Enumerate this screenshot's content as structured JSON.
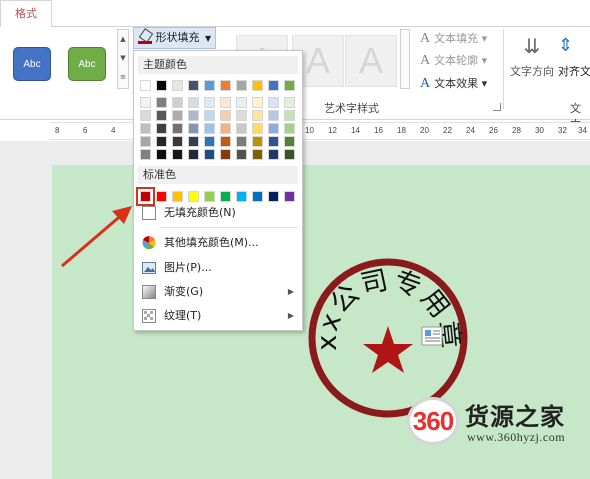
{
  "tabs": {
    "format": "格式"
  },
  "ribbon": {
    "shape_styles": [
      "Abc",
      "Abc"
    ],
    "shape_fill_label": "形状填充",
    "wordart_glyph": "A",
    "wordart_group_label": "艺术字样式",
    "text_fill": "文本填充",
    "text_outline": "文本轮廓",
    "text_effects": "文本效果",
    "text_direction": "文字方向",
    "align_text": "对齐文",
    "text_group_label": "文本"
  },
  "ruler": {
    "ticks": [
      "8",
      "6",
      "4",
      "10",
      "12",
      "14",
      "16",
      "18",
      "20",
      "22",
      "24",
      "26",
      "28",
      "30",
      "32",
      "34",
      "36"
    ]
  },
  "dropdown": {
    "theme_colors_header": "主题颜色",
    "standard_colors_header": "标准色",
    "theme_colors": [
      [
        "#ffffff",
        "#f2f2f2",
        "#d9d9d9",
        "#bfbfbf",
        "#a6a6a6",
        "#808080"
      ],
      [
        "#000000",
        "#7f7f7f",
        "#595959",
        "#404040",
        "#262626",
        "#0d0d0d"
      ],
      [
        "#e7e6e6",
        "#d0cece",
        "#aeabab",
        "#757171",
        "#3a3838",
        "#171616"
      ],
      [
        "#44546a",
        "#d6dce4",
        "#adb9ca",
        "#8496b0",
        "#333f4f",
        "#222a35"
      ],
      [
        "#5b9bd5",
        "#deebf6",
        "#bdd7ee",
        "#9dc3e6",
        "#2e75b5",
        "#1f4e79"
      ],
      [
        "#ed7d31",
        "#fbe5d5",
        "#f8cbad",
        "#f4b183",
        "#c55a11",
        "#833c0b"
      ],
      [
        "#a5a5a5",
        "#ededed",
        "#dbdbdb",
        "#c9c9c9",
        "#7b7b7b",
        "#525252"
      ],
      [
        "#ffc000",
        "#fff2cc",
        "#fee599",
        "#ffd966",
        "#bf9000",
        "#7f6000"
      ],
      [
        "#4472c4",
        "#dae3f3",
        "#b4c7e7",
        "#8faadc",
        "#2f5597",
        "#203864"
      ],
      [
        "#70ad47",
        "#e2efd9",
        "#c5e0b3",
        "#a8d08d",
        "#538135",
        "#375623"
      ]
    ],
    "standard_colors": [
      "#c00000",
      "#ff0000",
      "#ffc000",
      "#ffff00",
      "#92d050",
      "#00b050",
      "#00b0f0",
      "#0070c0",
      "#002060",
      "#7030a0"
    ],
    "selected_color": "#c00000",
    "no_fill": "无填充颜色(N)",
    "more_colors": "其他填充颜色(M)...",
    "picture": "图片(P)...",
    "gradient": "渐变(G)",
    "texture": "纹理(T)"
  },
  "seal": {
    "text": "xx公司专用章",
    "ring_color": "#8b1a1a",
    "star_color": "#b01515"
  },
  "watermark": {
    "logo": "360",
    "name": "货源之家",
    "url": "www.360hyzj.com"
  }
}
